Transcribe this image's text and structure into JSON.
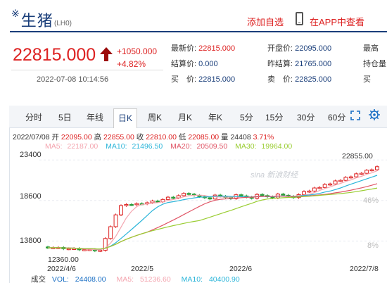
{
  "header": {
    "mark": "※",
    "title": "生猪",
    "code": "(LH0)",
    "add_favorite": "添加自选",
    "app_link": "在APP中查看"
  },
  "quote": {
    "price": "22815.000",
    "change": "+1050.000",
    "change_pct": "+4.82%",
    "datetime": "2022-07-08 10:14:56",
    "up_color": "#dd2222"
  },
  "stats": {
    "col1": [
      {
        "label": "最新价:",
        "value": "22815.000",
        "up": true
      },
      {
        "label": "结算价:",
        "value": "0.000",
        "up": false
      },
      {
        "label": "买　价:",
        "value": "22815.000",
        "up": false
      }
    ],
    "col2": [
      {
        "label": "开盘价:",
        "value": "22095.000",
        "up": false
      },
      {
        "label": "昨结算:",
        "value": "21765.000",
        "up": false
      },
      {
        "label": "卖　价:",
        "value": "22825.000",
        "up": false
      }
    ],
    "col3": [
      {
        "label": "最高",
        "value": ""
      },
      {
        "label": "持仓量",
        "value": ""
      },
      {
        "label": "买",
        "value": ""
      }
    ]
  },
  "tabs": [
    "分时",
    "5日",
    "年线",
    "日K",
    "周K",
    "月K",
    "年K",
    "5分",
    "15分",
    "30分",
    "60分"
  ],
  "active_tab": "日K",
  "kline_info": {
    "date": "2022/07/08",
    "open_label": "开",
    "open": "22095.00",
    "high_label": "高",
    "high": "22855.00",
    "close_label": "收",
    "close": "22810.00",
    "low_label": "低",
    "low": "22085.00",
    "vol_label": "量",
    "vol": "24408",
    "pct": "3.71%"
  },
  "ma": [
    {
      "label": "MA5:",
      "value": "22187.00",
      "color": "#f4a6b0"
    },
    {
      "label": "MA10:",
      "value": "21496.50",
      "color": "#2bb5d9"
    },
    {
      "label": "MA20:",
      "value": "20509.50",
      "color": "#e05566"
    },
    {
      "label": "MA30:",
      "value": "19964.00",
      "color": "#9acd32"
    }
  ],
  "chart_data": {
    "type": "candlestick",
    "y_ticks": [
      "23400",
      "18600",
      "13800"
    ],
    "pct_ticks": [
      "46%",
      "8%"
    ],
    "x_ticks": [
      "2022/4/6",
      "2022/5",
      "2022/6",
      "2022/7/8"
    ],
    "low_marker": "12360.00",
    "high_marker": "22855.00",
    "ylim": [
      12000,
      24000
    ]
  },
  "volume": {
    "label": "成交",
    "items": [
      {
        "label": "VOL:",
        "value": "24408.00"
      },
      {
        "label": "MA5:",
        "value": "51236.60"
      },
      {
        "label": "MA10:",
        "value": "40400.90"
      }
    ]
  },
  "watermark": "sina 新浪财经"
}
